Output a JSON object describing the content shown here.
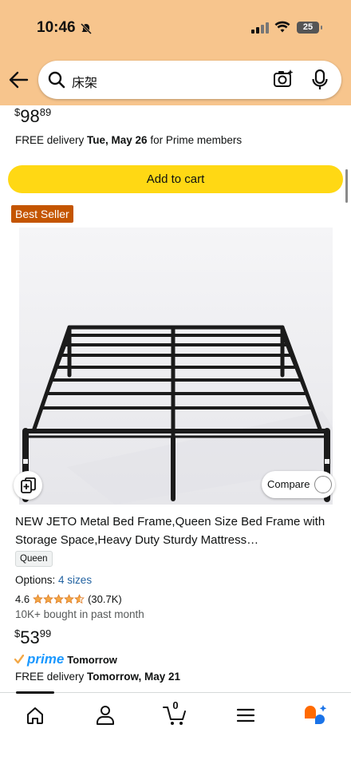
{
  "status_bar": {
    "time": "10:46",
    "battery": "25"
  },
  "search": {
    "query": "床架"
  },
  "prev_item": {
    "price_symbol": "$",
    "price_whole": "98",
    "price_cents": "89",
    "delivery_prefix": "FREE delivery ",
    "delivery_date": "Tue, May 26",
    "delivery_suffix": " for Prime members",
    "add_to_cart_label": "Add to cart"
  },
  "product": {
    "badge": "Best Seller",
    "compare_label": "Compare",
    "title": "NEW JETO Metal Bed Frame,Queen Size Bed Frame with Storage Space,Heavy Duty Sturdy Mattress…",
    "size_badge": "Queen",
    "options_label": "Options:",
    "options_value": "4 sizes",
    "rating_value": "4.6",
    "rating_stars": 4.6,
    "rating_count": "(30.7K)",
    "bought": "10K+ bought in past month",
    "price_symbol": "$",
    "price_whole": "53",
    "price_cents": "99",
    "prime_brand": "prime",
    "prime_day": "Tomorrow",
    "delivery_prefix": "FREE delivery ",
    "delivery_date": "Tomorrow, May 21"
  },
  "bottom_nav": {
    "cart_count": "0"
  },
  "colors": {
    "header_bg": "#f7c58d",
    "add_to_cart": "#ffd814",
    "best_seller": "#c45500",
    "link": "#2162a1",
    "star": "#f3a847",
    "prime": "#1a98ff"
  },
  "icons": [
    "back-arrow-icon",
    "search-icon",
    "camera-icon",
    "mic-icon",
    "add-to-list-icon",
    "home-icon",
    "account-icon",
    "cart-icon",
    "menu-icon",
    "ai-assistant-icon"
  ]
}
